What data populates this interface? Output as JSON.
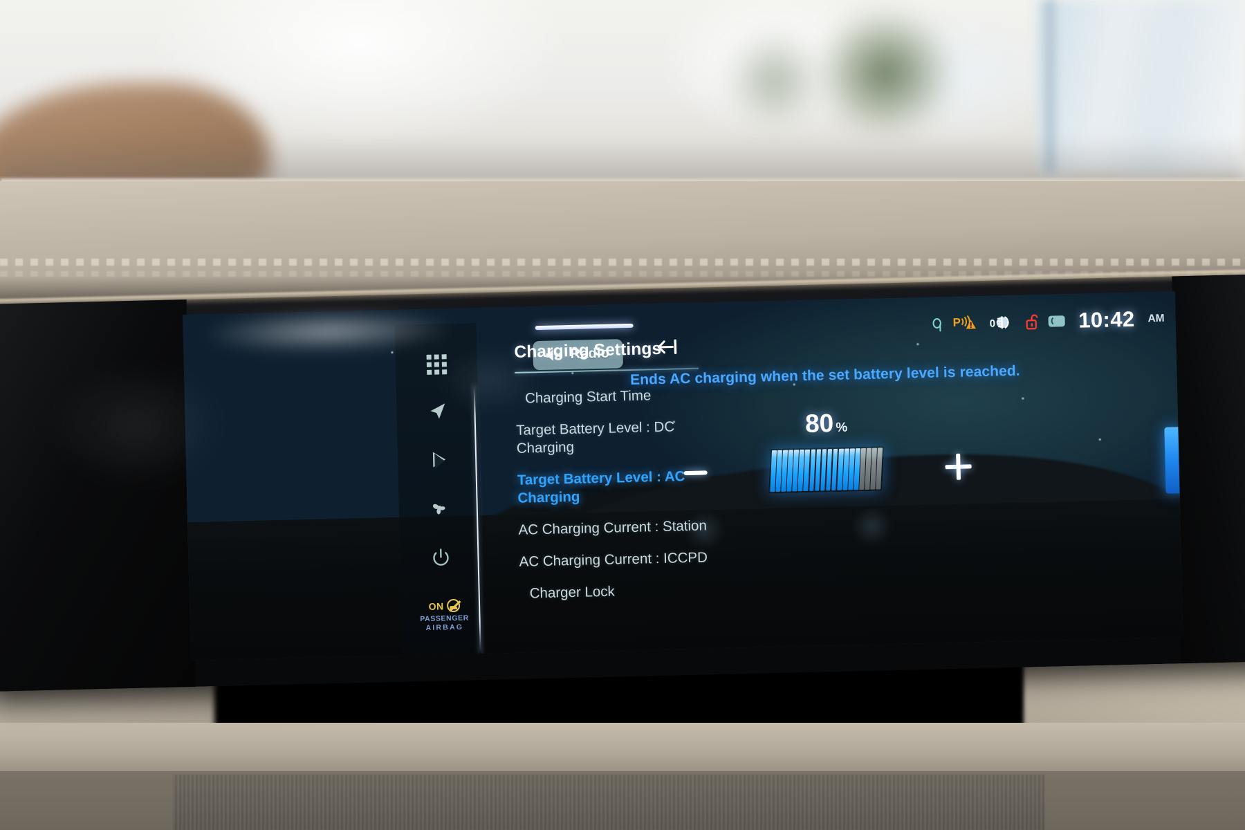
{
  "sidebar": {
    "items": [
      {
        "name": "apps-grid",
        "icon": "apps-grid-icon"
      },
      {
        "name": "navigation",
        "icon": "navigation-arrow-icon"
      },
      {
        "name": "media",
        "icon": "media-play-icon"
      },
      {
        "name": "climate",
        "icon": "climate-fan-icon"
      },
      {
        "name": "power",
        "icon": "power-icon"
      }
    ],
    "airbag_indicator": {
      "state": "ON",
      "line1": "PASSENGER",
      "line2": "AIRBAG",
      "state_color": "#e8c84a",
      "label_color": "#7f9fd4"
    }
  },
  "menu": {
    "title": "Charging Settings",
    "back_icon": "back-arrow-icon",
    "items": [
      {
        "label": "Charging Start Time",
        "active": false
      },
      {
        "label": "Target Battery Level : DC Charging",
        "active": false
      },
      {
        "label": "Target Battery Level : AC Charging",
        "active": true
      },
      {
        "label": "AC Charging Current : Station",
        "active": false
      },
      {
        "label": "AC Charging Current : ICCPD",
        "active": false
      },
      {
        "label": "Charger Lock",
        "active": false
      }
    ],
    "active_color": "#2fa4ff",
    "idle_color": "#c9dbe0"
  },
  "media": {
    "pill_label": "Radio",
    "pill_icon": "speaker-mute-icon"
  },
  "status_bar": {
    "icons": [
      {
        "name": "qi-wireless-charging-icon",
        "color": "#7fd4cf"
      },
      {
        "name": "parking-sensor-warning-icon",
        "color": "#f0a020"
      },
      {
        "name": "auto-headlight-icon",
        "color": "#ffffff"
      },
      {
        "name": "door-unlocked-icon",
        "color": "#ff3b30"
      },
      {
        "name": "screen-card-icon",
        "color": "#8fc3c8"
      }
    ],
    "time": "10:42",
    "meridiem": "AM"
  },
  "main": {
    "description": "Ends AC charging when the set battery level is reached.",
    "target_value": "80",
    "percent_symbol": "%",
    "decrease_label": "-",
    "increase_label": "+",
    "battery_fill_color": "#18a3ff",
    "battery_empty_color": "#8e9899",
    "description_color": "#4aa9ff"
  },
  "chart_data": {
    "type": "bar",
    "title": "Target Battery Level : AC Charging",
    "categories": [
      "charge-target"
    ],
    "values": [
      80
    ],
    "ylim": [
      0,
      100
    ],
    "ylabel": "%",
    "segments_total": 20,
    "segments_filled": 16
  }
}
